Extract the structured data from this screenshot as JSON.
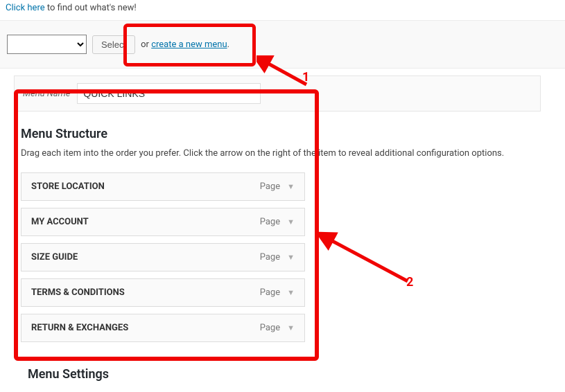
{
  "top_banner": {
    "link_text": "Click here",
    "rest_text": " to find out what's new!"
  },
  "action_bar": {
    "select_button": "Select",
    "or_text": "or ",
    "create_link": "create a new menu",
    "period": "."
  },
  "menu_name": {
    "label": "Menu Name",
    "value": "QUICK LINKS"
  },
  "structure": {
    "heading": "Menu Structure",
    "description": "Drag each item into the order you prefer. Click the arrow on the right of the item to reveal additional configuration options.",
    "items": [
      {
        "title": "STORE LOCATION",
        "type": "Page"
      },
      {
        "title": "MY ACCOUNT",
        "type": "Page"
      },
      {
        "title": "SIZE GUIDE",
        "type": "Page"
      },
      {
        "title": "TERMS & CONDITIONS",
        "type": "Page"
      },
      {
        "title": "RETURN & EXCHANGES",
        "type": "Page"
      }
    ]
  },
  "settings": {
    "heading": "Menu Settings"
  },
  "annotations": {
    "label1": "1",
    "label2": "2"
  }
}
